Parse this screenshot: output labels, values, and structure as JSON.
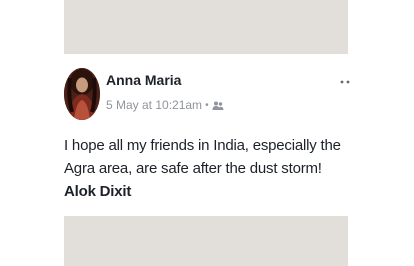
{
  "post": {
    "author": "Anna Maria",
    "timestamp": "5 May at 10:21am",
    "separator": "•",
    "audience_icon": "friends-icon",
    "more_icon": "more-options-icon",
    "body_text": "I hope all my friends in India, especially the Agra area, are safe after the dust storm!",
    "mention": "Alok Dixit"
  },
  "colors": {
    "placeholder_gray": "#e2dfdb",
    "text": "#1d2129",
    "meta": "#90949c"
  }
}
